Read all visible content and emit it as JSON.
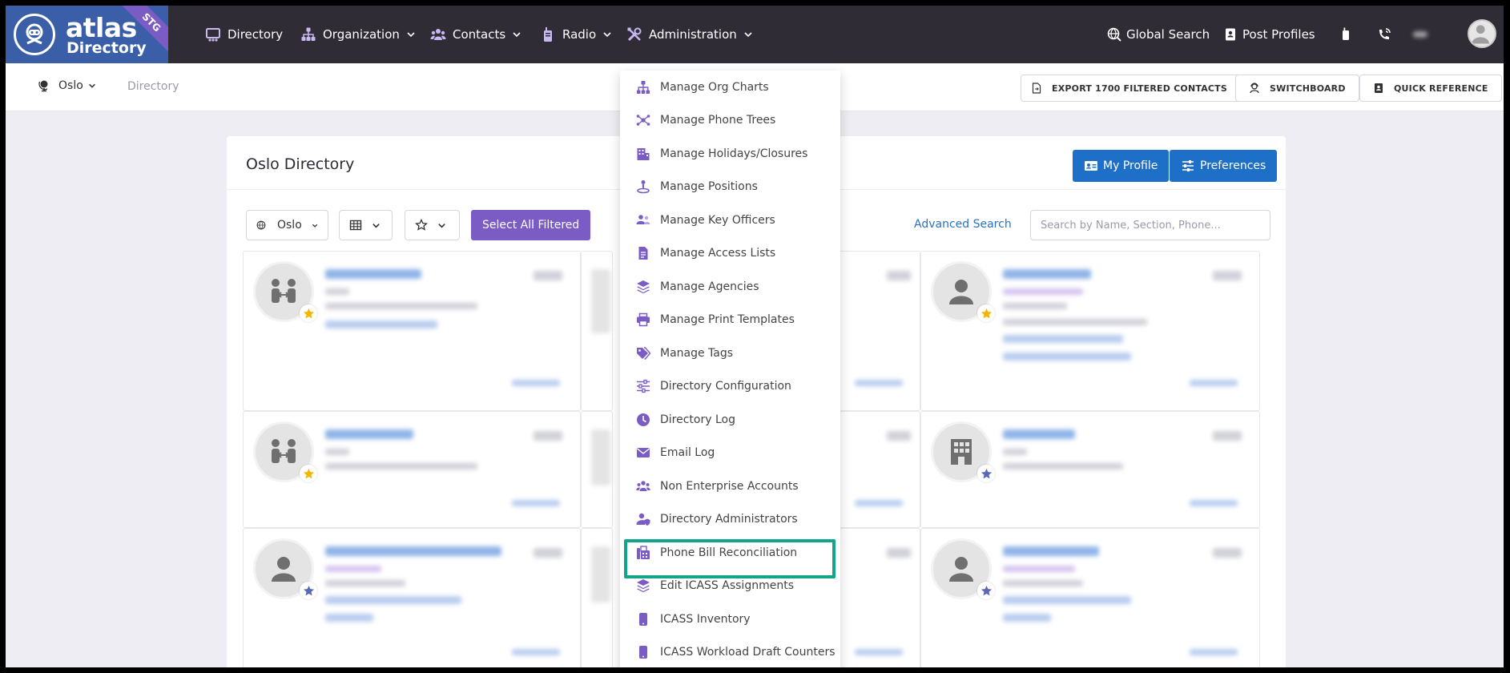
{
  "brand": {
    "title": "atlas",
    "subtitle": "Directory",
    "env": "STG",
    "color": "#3a5fa8"
  },
  "nav": {
    "directory": "Directory",
    "organization": "Organization",
    "contacts": "Contacts",
    "radio": "Radio",
    "administration": "Administration",
    "global_search": "Global Search",
    "post_profiles": "Post Profiles"
  },
  "subbar": {
    "location": "Oslo",
    "breadcrumb": "Directory",
    "export_label": "EXPORT 1700 FILTERED CONTACTS",
    "switchboard_label": "SWITCHBOARD",
    "quick_ref_label": "QUICK REFERENCE"
  },
  "card": {
    "title": "Oslo Directory",
    "my_profile": "My Profile",
    "preferences": "Preferences",
    "filter_location": "Oslo",
    "select_all": "Select All Filtered",
    "advanced_search": "Advanced Search",
    "search_placeholder": "Search by Name, Section, Phone..."
  },
  "admin_menu": {
    "items": [
      {
        "label": "Manage Org Charts",
        "icon": "org-chart-icon"
      },
      {
        "label": "Manage Phone Trees",
        "icon": "phone-tree-icon"
      },
      {
        "label": "Manage Holidays/Closures",
        "icon": "building-icon"
      },
      {
        "label": "Manage Positions",
        "icon": "position-icon"
      },
      {
        "label": "Manage Key Officers",
        "icon": "key-officers-icon"
      },
      {
        "label": "Manage Access Lists",
        "icon": "access-list-icon"
      },
      {
        "label": "Manage Agencies",
        "icon": "layers-icon"
      },
      {
        "label": "Manage Print Templates",
        "icon": "print-icon"
      },
      {
        "label": "Manage Tags",
        "icon": "tags-icon"
      },
      {
        "label": "Directory Configuration",
        "icon": "sliders-icon"
      },
      {
        "label": "Directory Log",
        "icon": "clock-icon"
      },
      {
        "label": "Email Log",
        "icon": "envelope-icon"
      },
      {
        "label": "Non Enterprise Accounts",
        "icon": "users-icon"
      },
      {
        "label": "Directory Administrators",
        "icon": "admin-user-icon"
      },
      {
        "label": "Phone Bill Reconciliation",
        "icon": "fax-icon"
      },
      {
        "label": "Edit ICASS Assignments",
        "icon": "layers-icon"
      },
      {
        "label": "ICASS Inventory",
        "icon": "mobile-icon"
      },
      {
        "label": "ICASS Workload Draft Counters",
        "icon": "mobile-icon"
      }
    ],
    "highlighted": "Phone Bill Reconciliation",
    "highlight_color": "#12a58a",
    "icon_color": "#7b5cc4"
  }
}
